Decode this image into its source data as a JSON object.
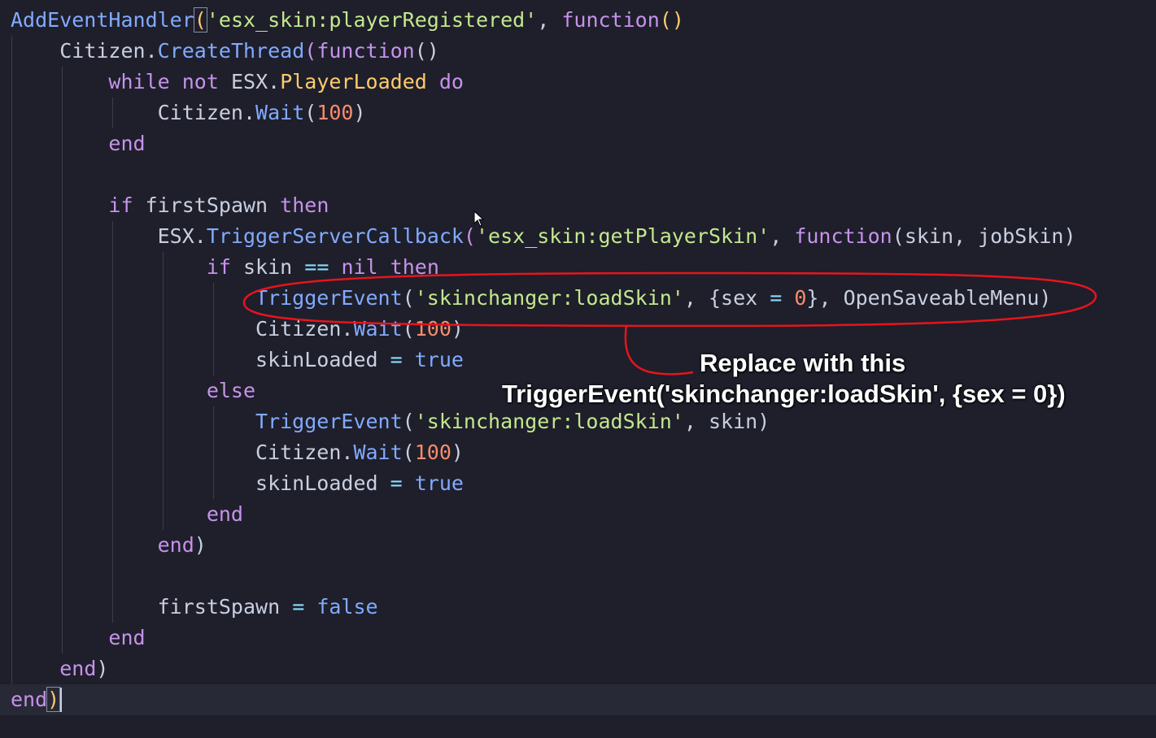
{
  "code": {
    "l1_handler": "AddEventHandler",
    "l1_event": "'esx_skin:playerRegistered'",
    "l1_function": "function",
    "l2_citizen": "Citizen",
    "l2_createthread": "CreateThread",
    "l2_function": "function",
    "l3_while": "while",
    "l3_not": "not",
    "l3_esx": "ESX",
    "l3_playerloaded": "PlayerLoaded",
    "l3_do": "do",
    "l4_citizen": "Citizen",
    "l4_wait": "Wait",
    "l4_num": "100",
    "l5_end": "end",
    "l7_if": "if",
    "l7_firstspawn": "firstSpawn",
    "l7_then": "then",
    "l8_esx": "ESX",
    "l8_callback": "TriggerServerCallback",
    "l8_event": "'esx_skin:getPlayerSkin'",
    "l8_function": "function",
    "l8_params": "skin, jobSkin",
    "l9_if": "if",
    "l9_skin": "skin",
    "l9_eq": "==",
    "l9_nil": "nil",
    "l9_then": "then",
    "l10_trigger": "TriggerEvent",
    "l10_event": "'skinchanger:loadSkin'",
    "l10_sex": "sex",
    "l10_eq": "=",
    "l10_num": "0",
    "l10_menu": "OpenSaveableMenu",
    "l11_citizen": "Citizen",
    "l11_wait": "Wait",
    "l11_num": "100",
    "l12_var": "skinLoaded",
    "l12_eq": "=",
    "l12_val": "true",
    "l13_else": "else",
    "l14_trigger": "TriggerEvent",
    "l14_event": "'skinchanger:loadSkin'",
    "l14_arg": "skin",
    "l15_citizen": "Citizen",
    "l15_wait": "Wait",
    "l15_num": "100",
    "l16_var": "skinLoaded",
    "l16_eq": "=",
    "l16_val": "true",
    "l17_end": "end",
    "l18_end": "end",
    "l20_var": "firstSpawn",
    "l20_eq": "=",
    "l20_val": "false",
    "l21_end": "end",
    "l22_end": "end",
    "l23_end": "end"
  },
  "annotation": {
    "title": "Replace with this",
    "replacement": "TriggerEvent('skinchanger:loadSkin', {sex = 0})"
  },
  "colors": {
    "background": "#1e1f2b",
    "keyword": "#c792ea",
    "function": "#82aaff",
    "string": "#c3e88d",
    "number": "#f78c6c",
    "annotation_circle": "#e8141c"
  }
}
